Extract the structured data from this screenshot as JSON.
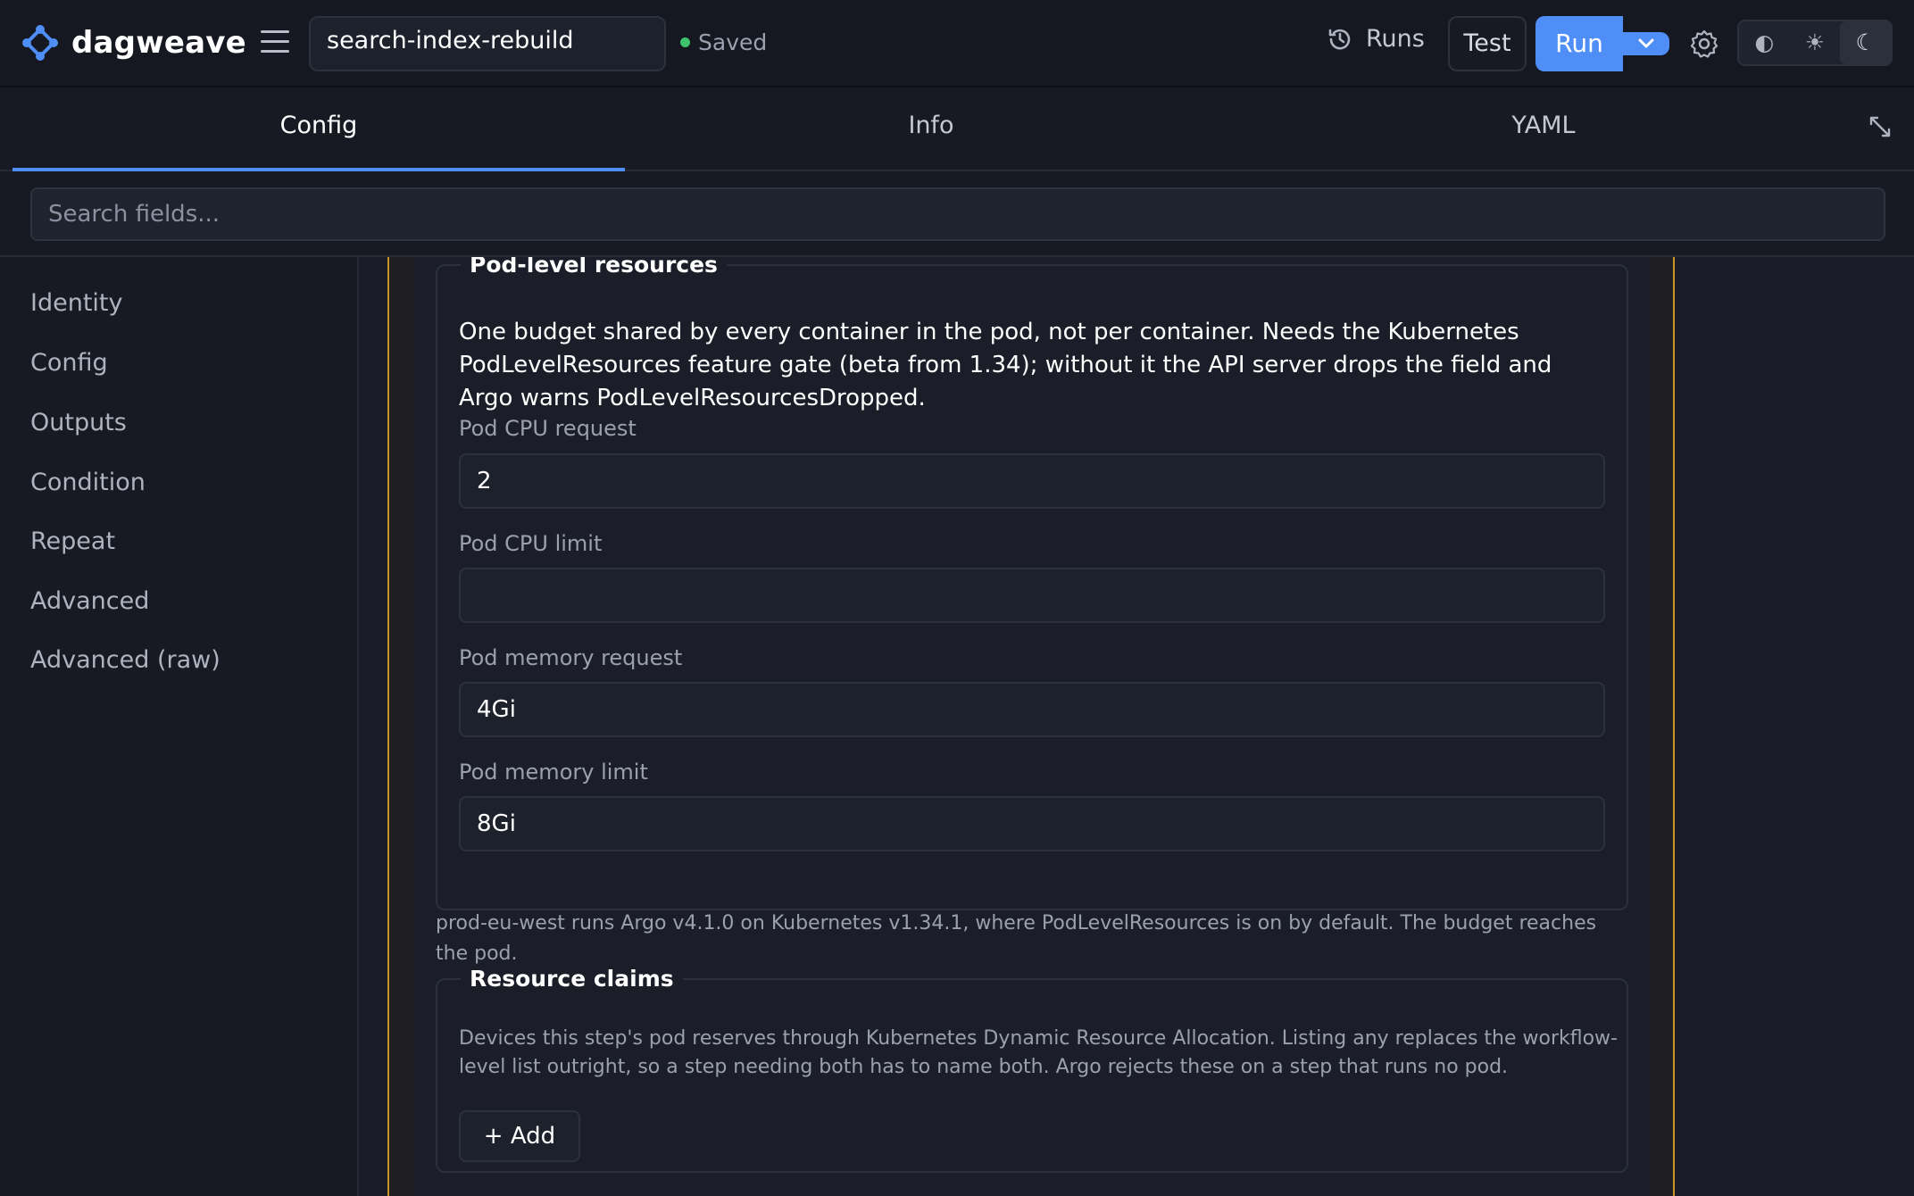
{
  "app": {
    "brand": "dagweave",
    "workflow_name": "search-index-rebuild",
    "save_status": "Saved",
    "status_color": "#3ec46d",
    "accent_color": "#4f8ef7",
    "warning_border_color": "#c99524"
  },
  "toolbar": {
    "runs_label": "Runs",
    "test_label": "Test",
    "run_label": "Run",
    "theme_options": [
      "◐",
      "☀",
      "☾"
    ],
    "theme_selected": "☾"
  },
  "tabs": [
    {
      "label": "Config",
      "active": true
    },
    {
      "label": "Info",
      "active": false
    },
    {
      "label": "YAML",
      "active": false
    }
  ],
  "expand_icon": "⤡",
  "search": {
    "placeholder": "Search fields...",
    "value": ""
  },
  "sidebar": {
    "items": [
      {
        "label": "Identity"
      },
      {
        "label": "Config"
      },
      {
        "label": "Outputs"
      },
      {
        "label": "Condition"
      },
      {
        "label": "Repeat"
      },
      {
        "label": "Advanced"
      },
      {
        "label": "Advanced (raw)"
      }
    ]
  },
  "pod_resources": {
    "title": "Pod-level resources",
    "description": "One budget shared by every container in the pod, not per container. Needs the Kubernetes PodLevelResources feature gate (beta from 1.34); without it the API server drops the field and Argo warns PodLevelResourcesDropped.",
    "fields": [
      {
        "label": "Pod CPU request",
        "value": "2"
      },
      {
        "label": "Pod CPU limit",
        "value": ""
      },
      {
        "label": "Pod memory request",
        "value": "4Gi"
      },
      {
        "label": "Pod memory limit",
        "value": "8Gi"
      }
    ],
    "note": "prod-eu-west runs Argo v4.1.0 on Kubernetes v1.34.1, where PodLevelResources is on by default. The budget reaches the pod."
  },
  "resource_claims": {
    "title": "Resource claims",
    "description": "Devices this step's pod reserves through Kubernetes Dynamic Resource Allocation. Listing any replaces the workflow-level list outright, so a step needing both has to name both. Argo rejects these on a step that runs no pod.",
    "add_label": "+ Add"
  }
}
